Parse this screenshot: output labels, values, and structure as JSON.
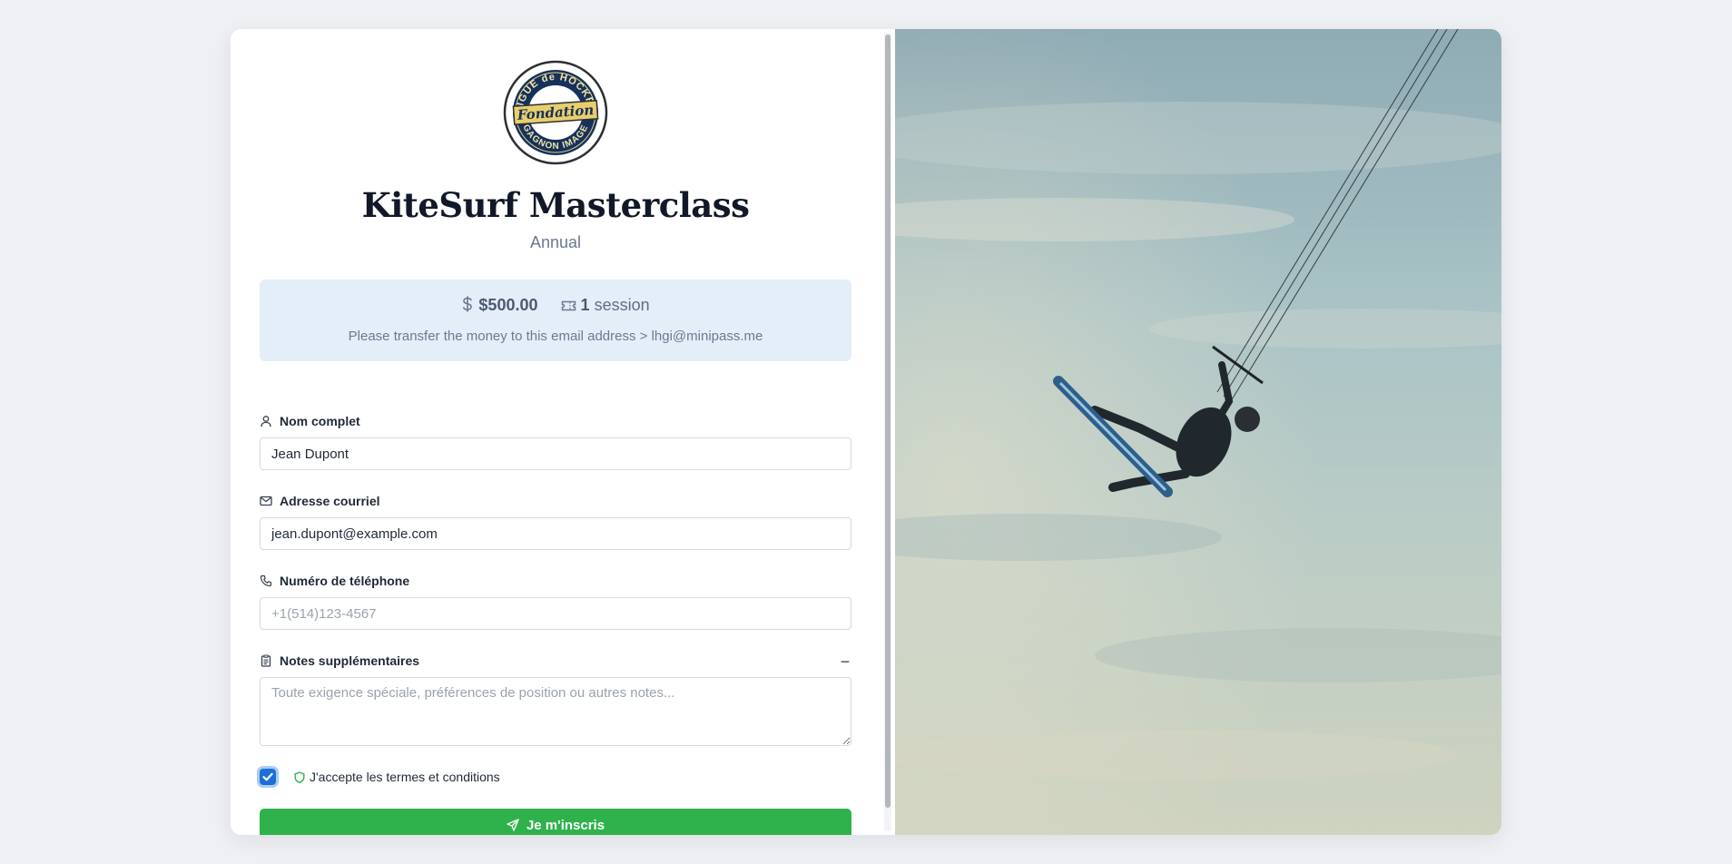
{
  "logo": {
    "top_text": "LIGUE de HOCKEY",
    "center_text": "Fondation",
    "bottom_text": "GAGNON IMAGE"
  },
  "title": "KiteSurf Masterclass",
  "subtitle": "Annual",
  "info": {
    "price": "$500.00",
    "sessions_count": "1",
    "sessions_label": "session",
    "note": "Please transfer the money to this email address > lhgi@minipass.me"
  },
  "form": {
    "name_label": "Nom complet",
    "name_value": "Jean Dupont",
    "email_label": "Adresse courriel",
    "email_value": "jean.dupont@example.com",
    "phone_label": "Numéro de téléphone",
    "phone_placeholder": "+1(514)123-4567",
    "notes_label": "Notes supplémentaires",
    "notes_placeholder": "Toute exigence spéciale, préférences de position ou autres notes...",
    "notes_toggle": "−",
    "terms_label": "J'accepte les termes et conditions",
    "terms_checked": true,
    "submit_label": "Je m'inscris"
  },
  "colors": {
    "accent": "#2fb24c",
    "checkbox": "#1d6fd6",
    "info_bg": "#e4eef8"
  },
  "icons": {
    "price": "dollar-icon",
    "sessions": "ticket-icon",
    "name": "user-icon",
    "email": "mail-icon",
    "phone": "phone-icon",
    "notes": "clipboard-icon",
    "terms": "shield-icon",
    "submit": "send-icon"
  }
}
